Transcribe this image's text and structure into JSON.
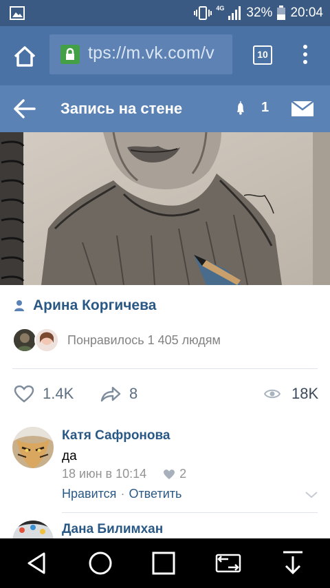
{
  "status_bar": {
    "network": "4G",
    "battery": "32%",
    "time": "20:04"
  },
  "browser": {
    "url": "tps://m.vk.com/v",
    "tab_count": "10"
  },
  "header": {
    "title": "Запись на стене",
    "notification_count": "1"
  },
  "post": {
    "author": "Арина Коргичева",
    "liked_by_text": "Понравилось 1 405 людям",
    "likes": "1.4K",
    "reposts": "8",
    "views": "18K"
  },
  "comments": [
    {
      "author": "Катя Сафронова",
      "text": "да",
      "date": "18 июн в 10:14",
      "likes": "2",
      "like_label": "Нравится",
      "reply_label": "Ответить"
    },
    {
      "author": "Дана Билимхан"
    }
  ],
  "colors": {
    "status_bar": "#3a5a84",
    "browser_bar": "#4a72a4",
    "vk_header": "#5b82b5",
    "link": "#2a5885",
    "secondary_text": "#828282"
  }
}
